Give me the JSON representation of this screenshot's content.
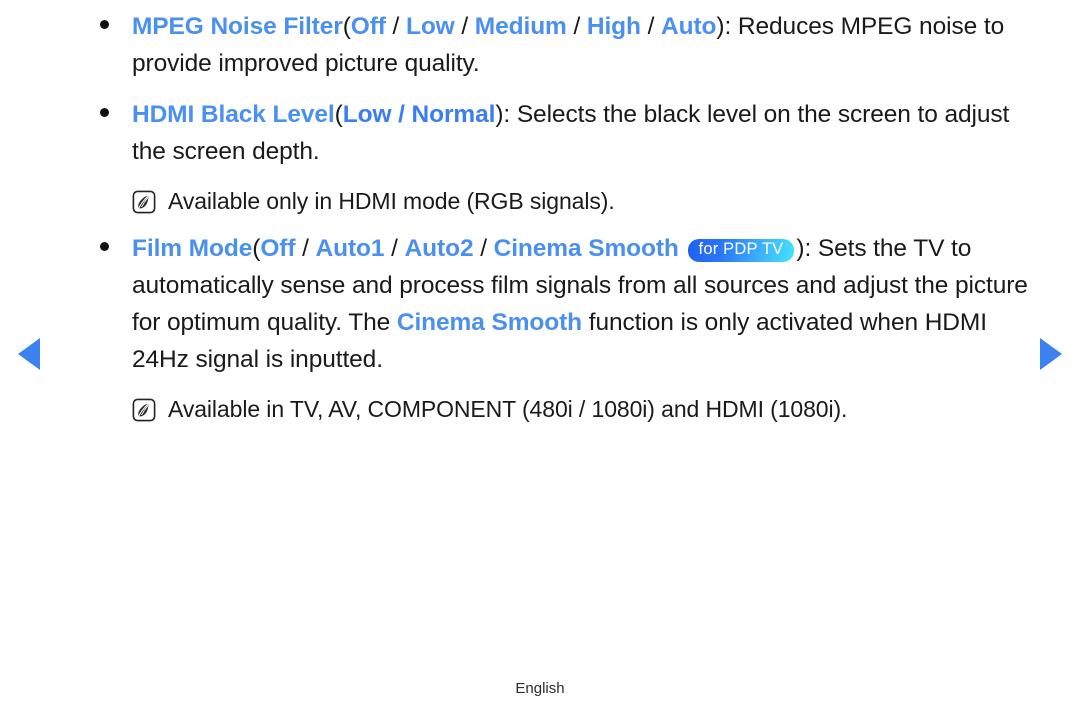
{
  "page": {
    "language_footer": "English"
  },
  "nav": {
    "prev_label": "◀",
    "next_label": "▶"
  },
  "badge": {
    "pdp_label": "for PDP TV",
    "gradient_from": "#1f5ff0",
    "gradient_to": "#43e3ff"
  },
  "colors": {
    "keyword_blue": "#4a90f0",
    "keyword_blue_deep": "#3b7df2",
    "text_black": "#1a1a1a",
    "arrow_blue": "#3b82f0"
  },
  "bullets": [
    {
      "id": "mpeg-noise-filter",
      "title": "MPEG Noise Filter",
      "open_paren": "(",
      "options": [
        "Off",
        "Low",
        "Medium",
        "High",
        "Auto"
      ],
      "separator": " / ",
      "close_paren": ")",
      "description": ": Reduces MPEG noise to provide improved picture quality.",
      "desc_part1": ": Reduces MPEG noise",
      "desc_part2": "to provide improved picture quality."
    },
    {
      "id": "hdmi-black-level",
      "title": "HDMI Black Level",
      "open_paren": "(",
      "options_inline": "Low / Normal",
      "close_paren": ")",
      "desc_part1": ": Selects the black level on the screen to",
      "desc_part2": "adjust the screen depth.",
      "note": "Available only in HDMI mode (RGB signals)."
    },
    {
      "id": "film-mode",
      "title": "Film Mode",
      "open_paren": "(",
      "options": [
        "Off",
        "Auto1",
        "Auto2",
        "Cinema Smooth"
      ],
      "separator": " / ",
      "close_paren": ")",
      "badge": "for PDP TV",
      "desc_part1": ": Sets the TV to",
      "desc_part2": "automatically sense and process film signals from all sources and adjust the",
      "desc_part3_pre": "picture for optimum quality. The ",
      "desc_part3_kw": "Cinema Smooth",
      "desc_part3_post": " function is only activated",
      "desc_part4": "when HDMI 24Hz signal is inputted.",
      "note": "Available in TV, AV, COMPONENT (480i / 1080i) and HDMI (1080i)."
    }
  ]
}
